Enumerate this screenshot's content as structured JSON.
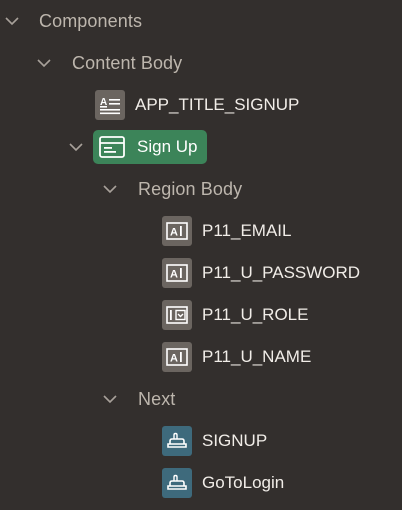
{
  "tree": {
    "components_label": "Components",
    "content_body_label": "Content Body",
    "app_title_label": "APP_TITLE_SIGNUP",
    "sign_up_label": "Sign Up",
    "region_body_label": "Region Body",
    "email_label": "P11_EMAIL",
    "password_label": "P11_U_PASSWORD",
    "role_label": "P11_U_ROLE",
    "name_label": "P11_U_NAME",
    "next_label": "Next",
    "signup_button_label": "SIGNUP",
    "gotologin_button_label": "GoToLogin"
  },
  "colors": {
    "background": "#332f2d",
    "selected": "#3c8459",
    "button_icon": "#3e6a7c",
    "item_icon": "#6b6560"
  },
  "icons": {
    "static_content": "static-content-icon",
    "region": "region-icon",
    "text_field": "text-field-icon",
    "select_list": "select-list-icon",
    "button": "button-icon",
    "chevron": "chevron-down-icon"
  }
}
